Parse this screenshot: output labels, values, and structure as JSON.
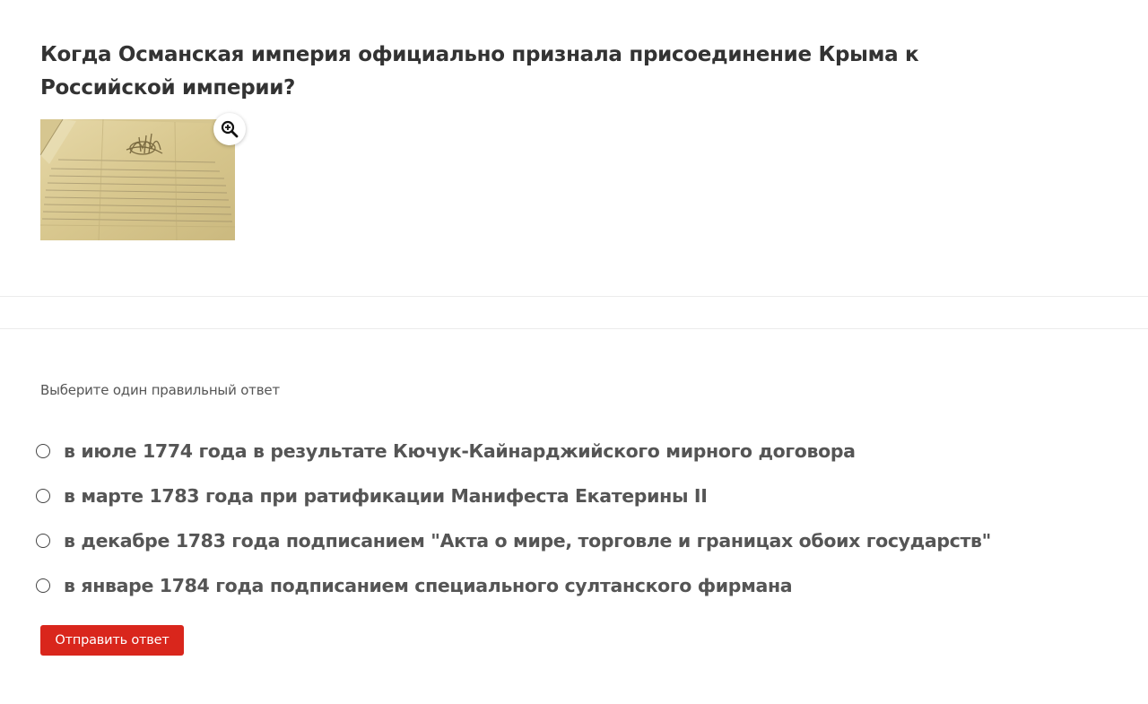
{
  "question": {
    "title": "Когда Османская империя официально признала присоединение Крыма к Российской империи?",
    "zoom_icon": "zoom-in-icon"
  },
  "instruction": "Выберите один правильный ответ",
  "options": [
    {
      "label": "в июле 1774 года в результате Кючук-Кайнарджийского мирного договора",
      "selected": false
    },
    {
      "label": "в марте 1783 года при ратификации Манифеста Екатерины II",
      "selected": false
    },
    {
      "label": "в декабре 1783 года подписанием \"Акта о мире, торговле и границах обоих государств\"",
      "selected": false
    },
    {
      "label": "в январе 1784 года подписанием специального султанского фирмана",
      "selected": false
    }
  ],
  "submit_label": "Отправить ответ",
  "colors": {
    "accent": "#d9261c",
    "text": "#555555",
    "title": "#333333"
  }
}
